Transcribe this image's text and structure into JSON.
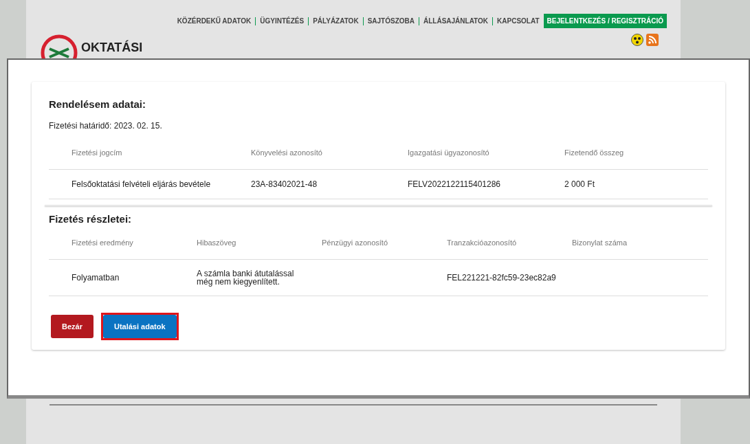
{
  "nav": {
    "items": [
      {
        "label": "KÖZÉRDEKŰ ADATOK",
        "selected": false
      },
      {
        "label": "ÜGYINTÉZÉS",
        "selected": false
      },
      {
        "label": "PÁLYÁZATOK",
        "selected": false
      },
      {
        "label": "SAJTÓSZOBA",
        "selected": false
      },
      {
        "label": "ÁLLÁSAJÁNLATOK",
        "selected": false
      },
      {
        "label": "KAPCSOLAT",
        "selected": false
      },
      {
        "label": "BEJELENTKEZÉS / REGISZTRÁCIÓ",
        "selected": true
      }
    ]
  },
  "logo": {
    "text": "OKTATÁSI"
  },
  "order": {
    "title": "Rendelésem adatai:",
    "deadline": "Fizetési határidő: 2023. 02. 15.",
    "columns": [
      "Fizetési jogcím",
      "Könyvelési azonosító",
      "Igazgatási ügyazonosító",
      "Fizetendő összeg"
    ],
    "rows": [
      [
        "Felsőoktatási felvételi eljárás bevétele",
        "23A-83402021-48",
        "FELV2022122115401286",
        "2 000 Ft"
      ]
    ]
  },
  "payment": {
    "title": "Fizetés részletei:",
    "columns": [
      "Fizetési eredmény",
      "Hibaszöveg",
      "Pénzügyi azonosító",
      "Tranzakcióazonosító",
      "Bizonylat száma"
    ],
    "rows": [
      [
        "Folyamatban",
        "A számla banki átutalással még nem kiegyenlített.",
        "",
        "FEL221221-82fc59-23ec82a9",
        ""
      ]
    ]
  },
  "buttons": [
    {
      "label": "Bezár",
      "kind": "close",
      "focused": false
    },
    {
      "label": "Utalási adatok",
      "kind": "primary",
      "focused": true
    }
  ]
}
